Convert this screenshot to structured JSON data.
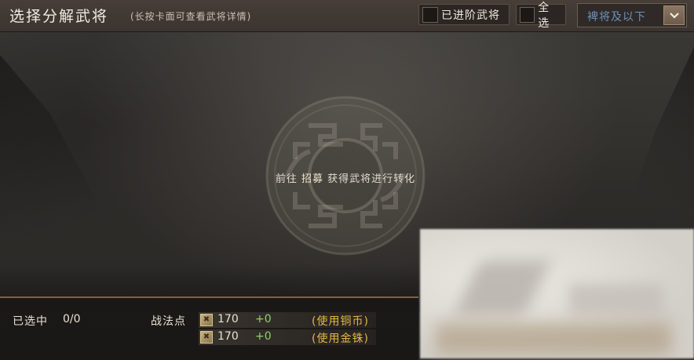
{
  "header": {
    "title": "选择分解武将",
    "hint": "(长按卡面可查看武将详情)",
    "checkbox_advanced": "已进阶武将",
    "checkbox_all": "全选",
    "filter_select": "裨将及以下"
  },
  "center": {
    "message_prefix": "前往",
    "message_link": "招募",
    "message_suffix": "获得武将进行转化"
  },
  "bottom": {
    "selected_label": "已选中",
    "selected_count": "0/0",
    "tactic_points_label": "战法点",
    "rows": [
      {
        "amount": "170",
        "bonus": "+0",
        "method": "(使用铜币)"
      },
      {
        "amount": "170",
        "bonus": "+0",
        "method": "(使用金铢)"
      }
    ]
  },
  "colors": {
    "bonus_green": "#8fd16b",
    "method_gold": "#e2b74a",
    "select_blue": "#6e8fb8"
  }
}
